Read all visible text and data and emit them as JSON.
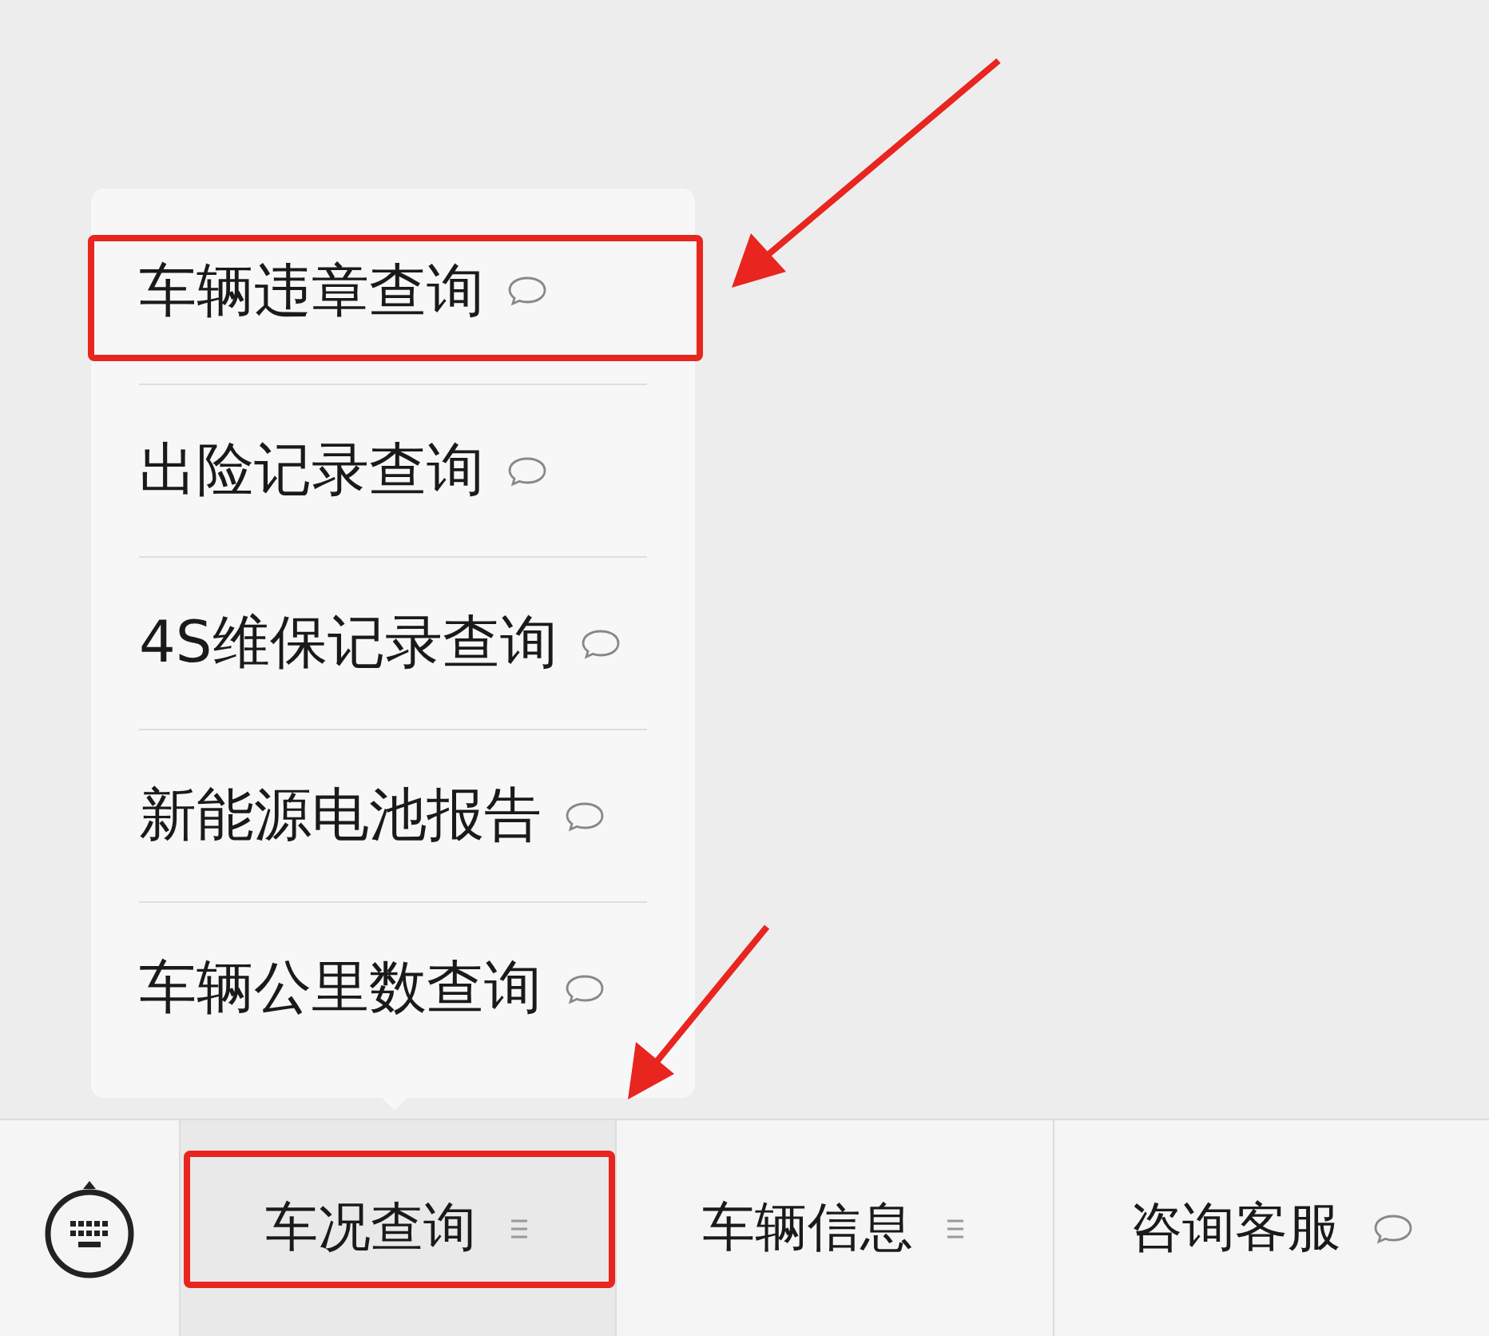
{
  "menu": {
    "items": [
      {
        "label": "车辆违章查询",
        "highlighted": true
      },
      {
        "label": "出险记录查询",
        "highlighted": false
      },
      {
        "label": "4S维保记录查询",
        "highlighted": false
      },
      {
        "label": "新能源电池报告",
        "highlighted": false
      },
      {
        "label": "车辆公里数查询",
        "highlighted": false
      }
    ]
  },
  "tabs": [
    {
      "label": "车况查询",
      "kind": "submenu",
      "expanded": true,
      "highlighted": true
    },
    {
      "label": "车辆信息",
      "kind": "submenu",
      "expanded": false,
      "highlighted": false
    },
    {
      "label": "咨询客服",
      "kind": "message",
      "expanded": false,
      "highlighted": false
    }
  ]
}
